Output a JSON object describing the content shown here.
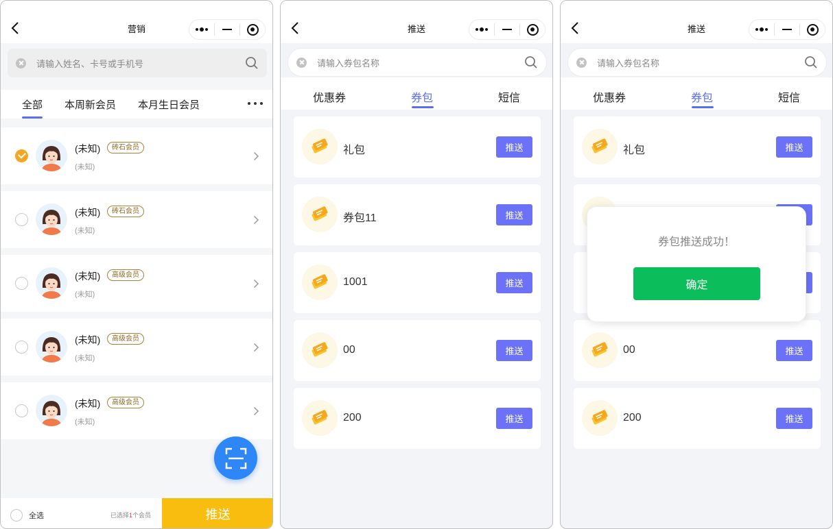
{
  "capsule_icons": [
    "more-dots-icon",
    "minimize-icon",
    "close-target-icon"
  ],
  "screen1": {
    "title": "营销",
    "search_placeholder": "请输入姓名、卡号或手机号",
    "tabs": [
      "全部",
      "本周新会员",
      "本月生日会员"
    ],
    "members": [
      {
        "name": "(未知)",
        "badge": "砖石会员",
        "sub": "(未知)",
        "checked": true
      },
      {
        "name": "(未知)",
        "badge": "砖石会员",
        "sub": "(未知)",
        "checked": false
      },
      {
        "name": "(未知)",
        "badge": "高级会员",
        "sub": "(未知)",
        "checked": false
      },
      {
        "name": "(未知)",
        "badge": "高级会员",
        "sub": "(未知)",
        "checked": false
      },
      {
        "name": "(未知)",
        "badge": "高级会员",
        "sub": "(未知)",
        "checked": false
      }
    ],
    "select_all": "全选",
    "selected_prefix": "已选择",
    "selected_count": "1",
    "selected_suffix": "个会员",
    "push_button": "推送"
  },
  "screen2": {
    "title": "推送",
    "search_placeholder": "请输入券包名称",
    "tabs": [
      "优惠券",
      "券包",
      "短信"
    ],
    "active_tab": "券包",
    "packages": [
      {
        "name": "礼包",
        "button": "推送"
      },
      {
        "name": "券包11",
        "button": "推送"
      },
      {
        "name": "1001",
        "button": "推送"
      },
      {
        "name": "00",
        "button": "推送"
      },
      {
        "name": "200",
        "button": "推送"
      }
    ]
  },
  "screen3": {
    "title": "推送",
    "search_placeholder": "请输入券包名称",
    "tabs": [
      "优惠券",
      "券包",
      "短信"
    ],
    "packages": [
      {
        "name": "礼包",
        "button": "推送"
      },
      {
        "name": "00",
        "button": "推送"
      },
      {
        "name": "200",
        "button": "推送"
      }
    ],
    "dialog": {
      "message": "券包推送成功！",
      "confirm": "确定"
    }
  },
  "colors": {
    "accent": "#5b6df0",
    "push_yellow": "#f9bd10",
    "confirm_green": "#0bbd5b",
    "scan_blue": "#2f86f6",
    "check_orange": "#f5a623"
  }
}
